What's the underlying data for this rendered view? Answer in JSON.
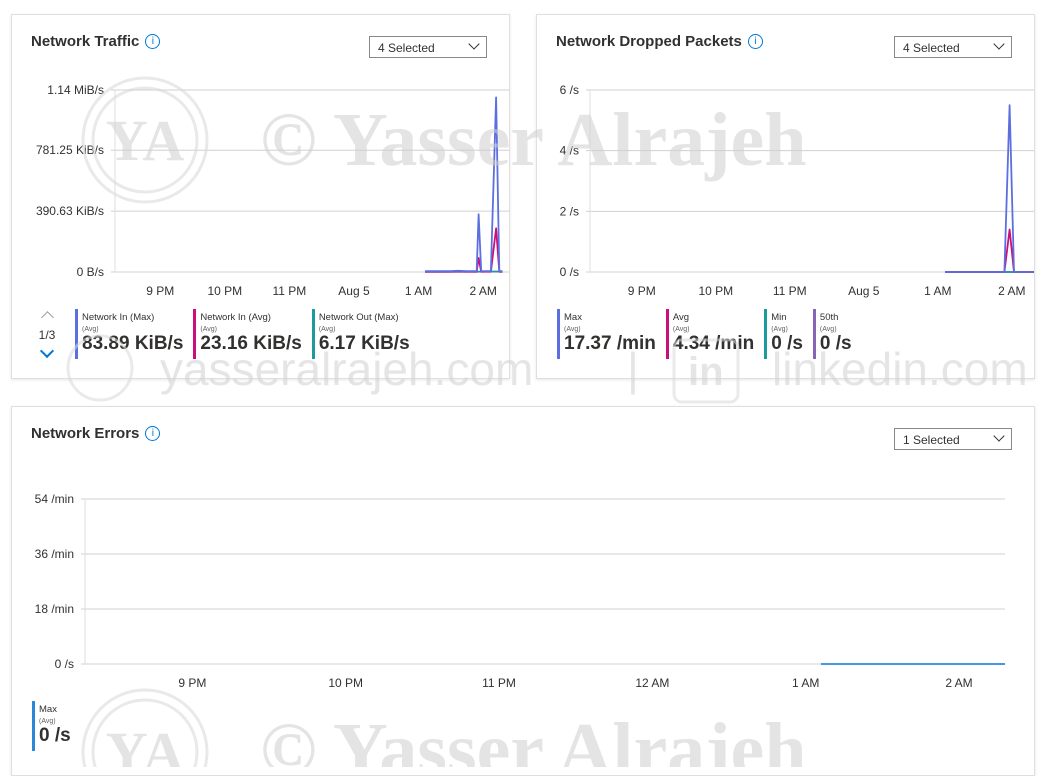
{
  "charts": {
    "traffic": {
      "title": "Network Traffic",
      "selector": "4 Selected",
      "pager": "1/3",
      "legend": [
        {
          "name": "Network In (Max)",
          "agg": "(Avg)",
          "value": "83.89 KiB/s",
          "color": "#5c6fe0"
        },
        {
          "name": "Network In (Avg)",
          "agg": "(Avg)",
          "value": "23.16 KiB/s",
          "color": "#cc0e7d"
        },
        {
          "name": "Network Out (Max)",
          "agg": "(Avg)",
          "value": "6.17 KiB/s",
          "color": "#1d9a9a"
        }
      ]
    },
    "dropped": {
      "title": "Network Dropped Packets",
      "selector": "4 Selected",
      "legend": [
        {
          "name": "Max",
          "agg": "(Avg)",
          "value": "17.37 /min",
          "color": "#5c6fe0"
        },
        {
          "name": "Avg",
          "agg": "(Avg)",
          "value": "4.34 /min",
          "color": "#cc0e7d"
        },
        {
          "name": "Min",
          "agg": "(Avg)",
          "value": "0 /s",
          "color": "#1d9a9a"
        },
        {
          "name": "50th",
          "agg": "(Avg)",
          "value": "0 /s",
          "color": "#8764b8"
        }
      ]
    },
    "errors": {
      "title": "Network Errors",
      "selector": "1 Selected",
      "legend": [
        {
          "name": "Max",
          "agg": "(Avg)",
          "value": "0 /s",
          "color": "#2b88d8"
        }
      ]
    }
  },
  "watermark": {
    "logo": "YA",
    "name": "©  Yasser Alrajeh",
    "site": "yasseralrajeh.com",
    "linkedin": "linkedin.com"
  },
  "chart_data": [
    {
      "type": "line",
      "title": "Network Traffic",
      "y_ticks": [
        "0 B/s",
        "390.63 KiB/s",
        "781.25 KiB/s",
        "1.14 MiB/s"
      ],
      "y_tick_values": [
        0,
        390.63,
        781.25,
        1167.36
      ],
      "ylim": [
        0,
        1167.36
      ],
      "x_ticks": [
        "9 PM",
        "10 PM",
        "11 PM",
        "Aug 5",
        "1 AM",
        "2 AM"
      ],
      "x_tick_hours": [
        21,
        22,
        23,
        24,
        25,
        26
      ],
      "xlim": [
        20.3,
        26.4
      ],
      "series": [
        {
          "name": "Network In (Max)",
          "color": "#5c6fe0",
          "x": [
            25.1,
            25.5,
            25.6,
            25.75,
            25.9,
            25.93,
            25.97,
            26.0,
            26.12,
            26.2,
            26.25,
            26.3
          ],
          "y": [
            5,
            5,
            8,
            5,
            6,
            370,
            6,
            5,
            6,
            1120,
            6,
            5
          ]
        },
        {
          "name": "Network In (Avg)",
          "color": "#cc0e7d",
          "x": [
            25.1,
            25.5,
            25.6,
            25.75,
            25.9,
            25.93,
            25.97,
            26.0,
            26.12,
            26.2,
            26.25,
            26.3
          ],
          "y": [
            2,
            2,
            3,
            2,
            2,
            90,
            2,
            2,
            2,
            280,
            2,
            2
          ]
        },
        {
          "name": "Network Out (Max)",
          "color": "#1d9a9a",
          "x": [
            25.1,
            25.9,
            26.2,
            26.3
          ],
          "y": [
            1,
            2,
            3,
            1
          ]
        }
      ]
    },
    {
      "type": "line",
      "title": "Network Dropped Packets",
      "y_ticks": [
        "0 /s",
        "2 /s",
        "4 /s",
        "6 /s"
      ],
      "y_tick_values": [
        0,
        2,
        4,
        6
      ],
      "ylim": [
        0,
        6
      ],
      "x_ticks": [
        "9 PM",
        "10 PM",
        "11 PM",
        "Aug 5",
        "1 AM",
        "2 AM"
      ],
      "x_tick_hours": [
        21,
        22,
        23,
        24,
        25,
        26
      ],
      "xlim": [
        20.3,
        26.3
      ],
      "series": [
        {
          "name": "Max",
          "color": "#5c6fe0",
          "x": [
            25.1,
            25.9,
            25.97,
            26.03,
            26.3
          ],
          "y": [
            0,
            0,
            5.5,
            0,
            0
          ]
        },
        {
          "name": "Avg",
          "color": "#cc0e7d",
          "x": [
            25.1,
            25.9,
            25.97,
            26.03,
            26.3
          ],
          "y": [
            0,
            0,
            1.4,
            0,
            0
          ]
        },
        {
          "name": "Min",
          "color": "#1d9a9a",
          "x": [
            25.1,
            26.3
          ],
          "y": [
            0,
            0
          ]
        },
        {
          "name": "50th",
          "color": "#8764b8",
          "x": [
            25.1,
            26.3
          ],
          "y": [
            0,
            0
          ]
        }
      ]
    },
    {
      "type": "line",
      "title": "Network Errors",
      "y_ticks": [
        "0 /s",
        "18 /min",
        "36 /min",
        "54 /min"
      ],
      "y_tick_values": [
        0,
        18,
        36,
        54
      ],
      "ylim": [
        0,
        54
      ],
      "x_ticks": [
        "9 PM",
        "10 PM",
        "11 PM",
        "12 AM",
        "1 AM",
        "2 AM"
      ],
      "x_tick_hours": [
        21,
        22,
        23,
        24,
        25,
        26
      ],
      "xlim": [
        20.3,
        26.3
      ],
      "series": [
        {
          "name": "Max",
          "color": "#2b88d8",
          "x": [
            25.1,
            26.3
          ],
          "y": [
            0,
            0
          ]
        }
      ]
    }
  ]
}
